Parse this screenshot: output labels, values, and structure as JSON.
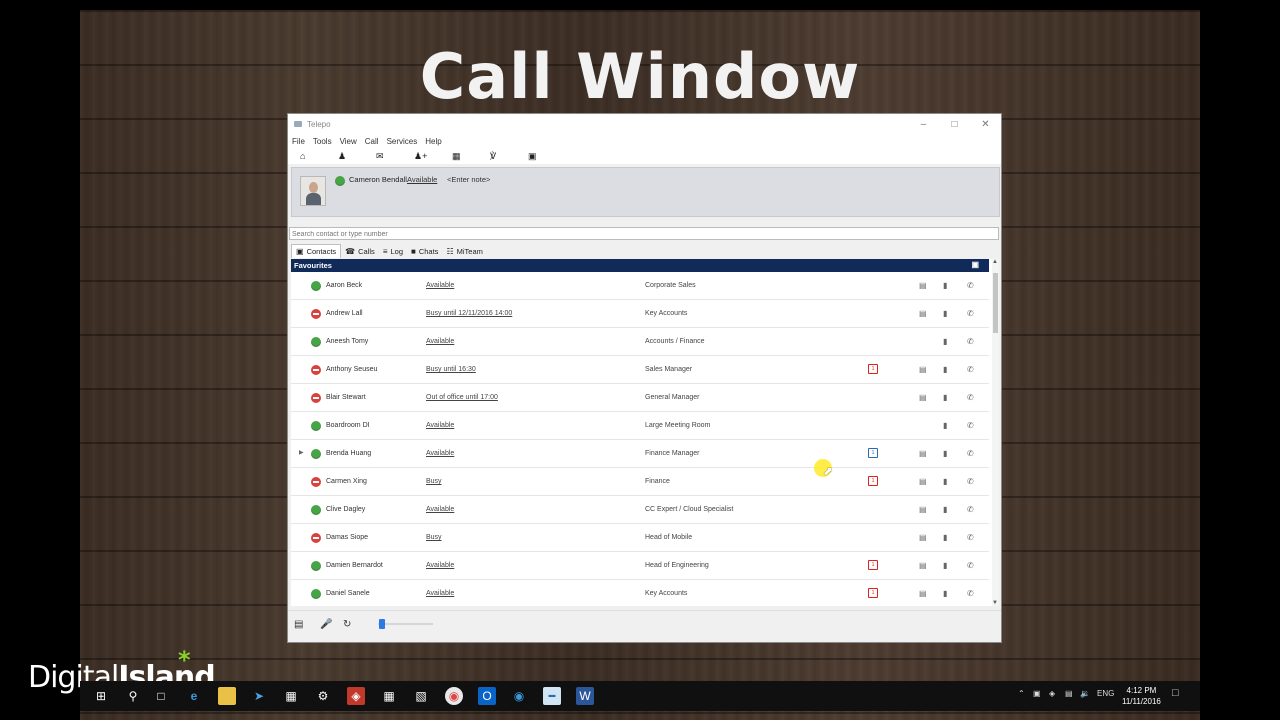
{
  "headline": "Call Window",
  "window": {
    "title": "Telepo",
    "controls": [
      "–",
      "□",
      "✕"
    ]
  },
  "menu": [
    "File",
    "Tools",
    "View",
    "Call",
    "Services",
    "Help"
  ],
  "toolbar_icons": [
    "home-icon",
    "user-icon",
    "mail-icon",
    "add-contact-icon",
    "calendar-icon",
    "queue-icon",
    "card-icon"
  ],
  "profile": {
    "name": "Cameron Bendall",
    "status": "Available",
    "note": "<Enter note>"
  },
  "search": {
    "placeholder": "Search contact or type number"
  },
  "tabs": [
    {
      "label": "Contacts",
      "icon": "▣"
    },
    {
      "label": "Calls",
      "icon": "☎"
    },
    {
      "label": "Log",
      "icon": "≡"
    },
    {
      "label": "Chats",
      "icon": "■"
    },
    {
      "label": "MiTeam",
      "icon": "☷"
    }
  ],
  "favourites_label": "Favourites",
  "contacts": [
    {
      "name": "Aaron Beck",
      "status": "Available",
      "dept": "Corporate Sales",
      "presence": "green",
      "calendar": "",
      "doc": true,
      "expand": false
    },
    {
      "name": "Andrew Lall",
      "status": "Busy until 12/11/2016 14:00",
      "dept": "Key Accounts",
      "presence": "red",
      "calendar": "",
      "doc": true,
      "expand": false
    },
    {
      "name": "Aneesh Tomy",
      "status": "Available",
      "dept": "Accounts / Finance",
      "presence": "green",
      "calendar": "",
      "doc": false,
      "expand": false
    },
    {
      "name": "Anthony Seuseu",
      "status": "Busy until 16:30",
      "dept": "Sales Manager",
      "presence": "red",
      "calendar": "red",
      "doc": true,
      "expand": false
    },
    {
      "name": "Blair Stewart",
      "status": "Out of office until 17:00",
      "dept": "General Manager",
      "presence": "red",
      "calendar": "",
      "doc": true,
      "expand": false
    },
    {
      "name": "Boardroom DI",
      "status": "Available",
      "dept": "Large Meeting Room",
      "presence": "green",
      "calendar": "",
      "doc": false,
      "expand": false
    },
    {
      "name": "Brenda Huang",
      "status": "Available",
      "dept": "Finance Manager",
      "presence": "green",
      "calendar": "blue",
      "doc": true,
      "expand": true
    },
    {
      "name": "Carmen Xing",
      "status": "Busy",
      "dept": "Finance",
      "presence": "red",
      "calendar": "red",
      "doc": true,
      "expand": false
    },
    {
      "name": "Clive Dagley",
      "status": "Available",
      "dept": "CC Expert / Cloud Specialist",
      "presence": "green",
      "calendar": "",
      "doc": true,
      "expand": false
    },
    {
      "name": "Damas Siope",
      "status": "Busy",
      "dept": "Head of Mobile",
      "presence": "red",
      "calendar": "",
      "doc": true,
      "expand": false
    },
    {
      "name": "Damien Bernardot",
      "status": "Available",
      "dept": "Head of Engineering",
      "presence": "green",
      "calendar": "red",
      "doc": true,
      "expand": false
    },
    {
      "name": "Daniel Sanele",
      "status": "Available",
      "dept": "Key Accounts",
      "presence": "green",
      "calendar": "red",
      "doc": true,
      "expand": false
    }
  ],
  "volume_level": 0.05,
  "brand": {
    "text_light": "Digital",
    "text_bold": "Island",
    "star": "*"
  },
  "taskbar": {
    "lang": "ENG",
    "time": "4:12 PM",
    "date": "11/11/2016"
  }
}
